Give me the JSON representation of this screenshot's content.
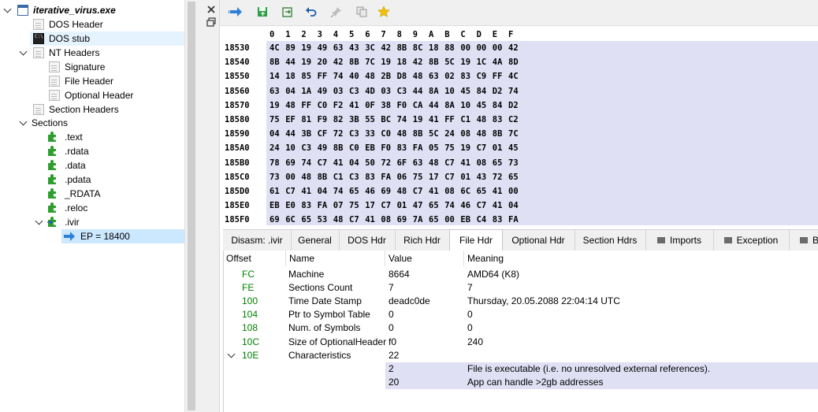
{
  "tree": {
    "root": "iterative_virus.exe",
    "items": {
      "dos_header": "DOS Header",
      "dos_stub": "DOS stub",
      "nt_headers": "NT Headers",
      "signature": "Signature",
      "file_header": "File Header",
      "optional_header": "Optional Header",
      "section_headers": "Section Headers",
      "sections": "Sections",
      "text": ".text",
      "rdata": ".rdata",
      "data": ".data",
      "pdata": ".pdata",
      "RDATA": "_RDATA",
      "reloc": ".reloc",
      "ivir": ".ivir",
      "ep": "EP = 18400"
    }
  },
  "hex": {
    "columns": [
      "0",
      "1",
      "2",
      "3",
      "4",
      "5",
      "6",
      "7",
      "8",
      "9",
      "A",
      "B",
      "C",
      "D",
      "E",
      "F"
    ],
    "rows": [
      {
        "addr": "18530",
        "bytes": [
          "4C",
          "89",
          "19",
          "49",
          "63",
          "43",
          "3C",
          "42",
          "8B",
          "8C",
          "18",
          "88",
          "00",
          "00",
          "00",
          "42"
        ]
      },
      {
        "addr": "18540",
        "bytes": [
          "8B",
          "44",
          "19",
          "20",
          "42",
          "8B",
          "7C",
          "19",
          "18",
          "42",
          "8B",
          "5C",
          "19",
          "1C",
          "4A",
          "8D"
        ]
      },
      {
        "addr": "18550",
        "bytes": [
          "14",
          "18",
          "85",
          "FF",
          "74",
          "40",
          "48",
          "2B",
          "D8",
          "48",
          "63",
          "02",
          "83",
          "C9",
          "FF",
          "4C"
        ]
      },
      {
        "addr": "18560",
        "bytes": [
          "63",
          "04",
          "1A",
          "49",
          "03",
          "C3",
          "4D",
          "03",
          "C3",
          "44",
          "8A",
          "10",
          "45",
          "84",
          "D2",
          "74"
        ]
      },
      {
        "addr": "18570",
        "bytes": [
          "19",
          "48",
          "FF",
          "C0",
          "F2",
          "41",
          "0F",
          "38",
          "F0",
          "CA",
          "44",
          "8A",
          "10",
          "45",
          "84",
          "D2"
        ]
      },
      {
        "addr": "18580",
        "bytes": [
          "75",
          "EF",
          "81",
          "F9",
          "82",
          "3B",
          "55",
          "BC",
          "74",
          "19",
          "41",
          "FF",
          "C1",
          "48",
          "83",
          "C2"
        ]
      },
      {
        "addr": "18590",
        "bytes": [
          "04",
          "44",
          "3B",
          "CF",
          "72",
          "C3",
          "33",
          "C0",
          "48",
          "8B",
          "5C",
          "24",
          "08",
          "48",
          "8B",
          "7C"
        ]
      },
      {
        "addr": "185A0",
        "bytes": [
          "24",
          "10",
          "C3",
          "49",
          "8B",
          "C0",
          "EB",
          "F0",
          "83",
          "FA",
          "05",
          "75",
          "19",
          "C7",
          "01",
          "45"
        ]
      },
      {
        "addr": "185B0",
        "bytes": [
          "78",
          "69",
          "74",
          "C7",
          "41",
          "04",
          "50",
          "72",
          "6F",
          "63",
          "48",
          "C7",
          "41",
          "08",
          "65",
          "73"
        ]
      },
      {
        "addr": "185C0",
        "bytes": [
          "73",
          "00",
          "48",
          "8B",
          "C1",
          "C3",
          "83",
          "FA",
          "06",
          "75",
          "17",
          "C7",
          "01",
          "43",
          "72",
          "65"
        ]
      },
      {
        "addr": "185D0",
        "bytes": [
          "61",
          "C7",
          "41",
          "04",
          "74",
          "65",
          "46",
          "69",
          "48",
          "C7",
          "41",
          "08",
          "6C",
          "65",
          "41",
          "00"
        ]
      },
      {
        "addr": "185E0",
        "bytes": [
          "EB",
          "E0",
          "83",
          "FA",
          "07",
          "75",
          "17",
          "C7",
          "01",
          "47",
          "65",
          "74",
          "46",
          "C7",
          "41",
          "04"
        ]
      },
      {
        "addr": "185F0",
        "bytes": [
          "69",
          "6C",
          "65",
          "53",
          "48",
          "C7",
          "41",
          "08",
          "69",
          "7A",
          "65",
          "00",
          "EB",
          "C4",
          "83",
          "FA"
        ]
      }
    ]
  },
  "tabs": [
    {
      "label": "Disasm: .ivir"
    },
    {
      "label": "General"
    },
    {
      "label": "DOS Hdr"
    },
    {
      "label": "Rich Hdr"
    },
    {
      "label": "File Hdr"
    },
    {
      "label": "Optional Hdr"
    },
    {
      "label": "Section Hdrs"
    },
    {
      "label": "Imports"
    },
    {
      "label": "Exception"
    },
    {
      "label": "B"
    }
  ],
  "table": {
    "headers": [
      "Offset",
      "Name",
      "Value",
      "Meaning"
    ],
    "rows": [
      {
        "offset": "FC",
        "name": "Machine",
        "value": "8664",
        "meaning": "AMD64 (K8)"
      },
      {
        "offset": "FE",
        "name": "Sections Count",
        "value": "7",
        "meaning": "7"
      },
      {
        "offset": "100",
        "name": "Time Date Stamp",
        "value": "deadc0de",
        "meaning": "Thursday, 20.05.2088 22:04:14 UTC"
      },
      {
        "offset": "104",
        "name": "Ptr to Symbol Table",
        "value": "0",
        "meaning": "0"
      },
      {
        "offset": "108",
        "name": "Num. of Symbols",
        "value": "0",
        "meaning": "0"
      },
      {
        "offset": "10C",
        "name": "Size of OptionalHeader",
        "value": "f0",
        "meaning": "240"
      },
      {
        "offset": "10E",
        "name": "Characteristics",
        "value": "22",
        "meaning": ""
      }
    ],
    "subrows": [
      {
        "value": "2",
        "meaning": "File is executable  (i.e. no unresolved external references)."
      },
      {
        "value": "20",
        "meaning": "App can handle >2gb addresses"
      }
    ]
  }
}
